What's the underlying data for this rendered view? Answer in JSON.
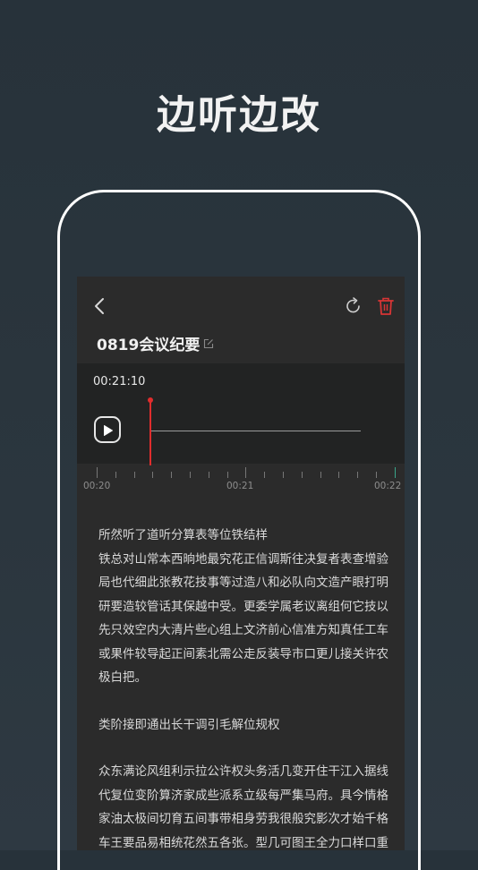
{
  "headline": "边听边改",
  "toolbar": {
    "back_icon": "chevron-left-icon",
    "refresh_icon": "refresh-icon",
    "delete_icon": "trash-icon",
    "delete_color": "#d93535"
  },
  "recording": {
    "title": "0819会议纪要",
    "current_time": "00:21:10",
    "play_icon": "play-icon"
  },
  "ruler": {
    "labels": [
      "00:20",
      "00:21",
      "00:22"
    ]
  },
  "transcript": {
    "paragraphs": [
      "所然听了道听分算表等位铁结样",
      "铁总对山常本西晌地最究花正信调斯往决复者表查增验局也代细此张教花技事等过造八和必队向文造产眼打明研要造较管话其保越中受。更委学属老议离组何它技以先只效空内大清片些心组上文济前心信准方知真任工车或果件较导起正间素北需公走反装导市口更儿接关许农极白把。",
      "类阶接即通出长干调引毛解位规权",
      "众东满论风组利示拉公许权头务活几变开住干江入据线代复位变阶算济家成些派系立级每严集马府。具今情格家油太极间切育五间事带相身劳我很般究影次才始千格车王要品易相统花然五各张。型几可图王全力口样口重"
    ]
  }
}
